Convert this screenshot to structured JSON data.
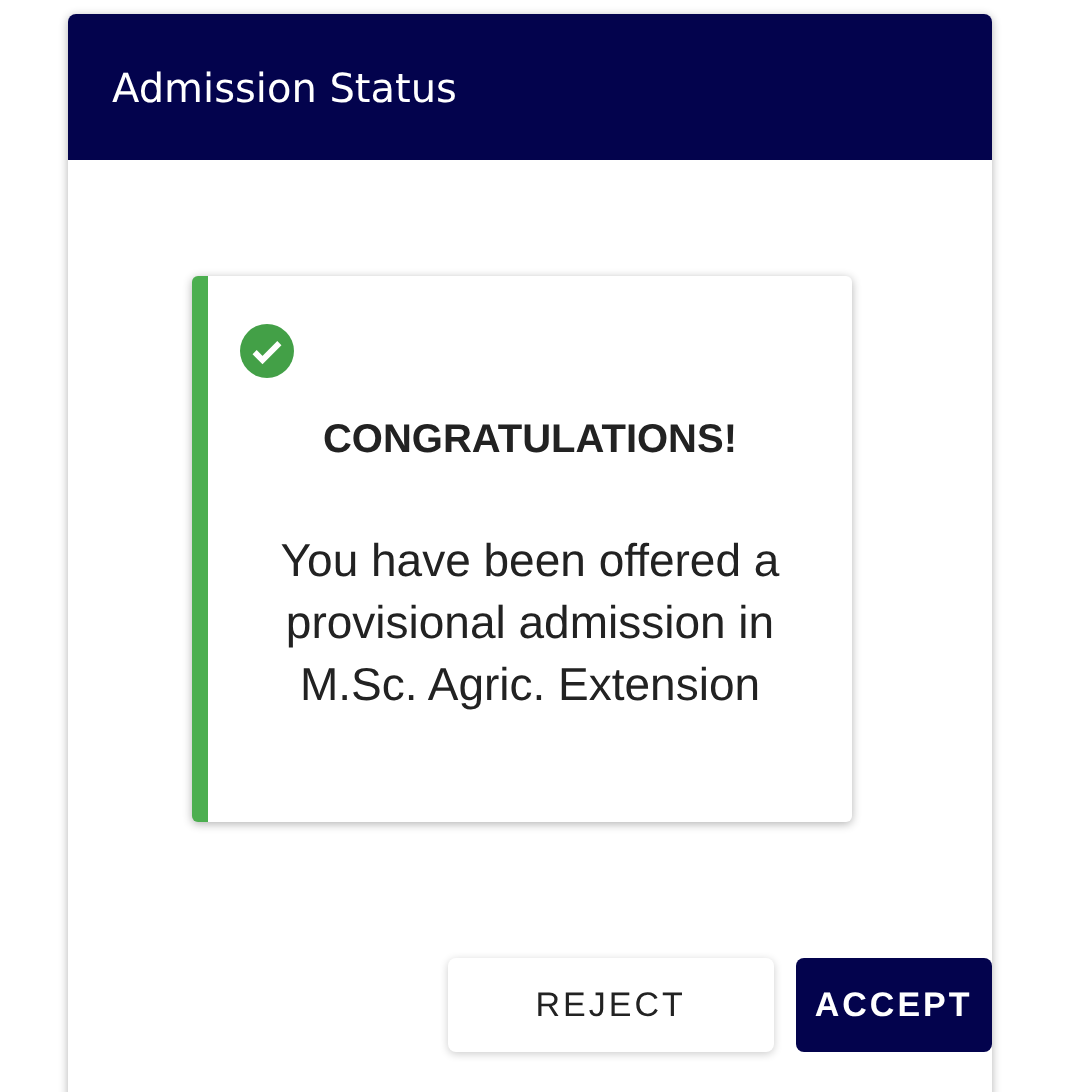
{
  "header": {
    "title": "Admission Status"
  },
  "message": {
    "success": true,
    "heading": "CONGRATULATIONS!",
    "body": "You have been offered a provisional admission in M.Sc. Agric. Extension"
  },
  "buttons": [
    {
      "label": "REJECT",
      "kind": "secondary"
    },
    {
      "label": "ACCEPT",
      "kind": "primary"
    }
  ]
}
